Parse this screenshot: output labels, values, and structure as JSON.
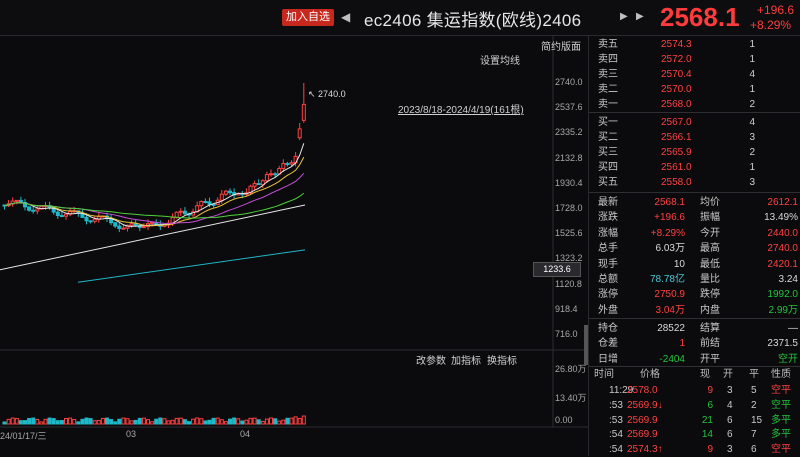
{
  "header": {
    "add_watchlist": "加入自选",
    "prev": "◀",
    "title": "ec2406 集运指数(欧线)2406",
    "next": "▶",
    "next2": "▶",
    "last_price": "2568.1",
    "change": "+196.6",
    "change_pct": "+8.29%"
  },
  "chart_toolbar": {
    "simple_panel": "简约版面",
    "ma_settings": "设置均线",
    "date_range": "2023/8/18-2024/4/19(161根)",
    "peak_label": "2740.0",
    "current_tag": "1233.6",
    "edit_params": "改参数",
    "add_indicator": "加指标",
    "change_indicator": "换指标"
  },
  "chart_data": {
    "type": "candlestick",
    "price_axis": [
      "2740.0",
      "2537.6",
      "2335.2",
      "2132.8",
      "1930.4",
      "1728.0",
      "1525.6",
      "1323.2",
      "1120.8",
      "918.4",
      "716.0"
    ],
    "volume_axis": [
      "26.80万",
      "13.40万",
      "0.00"
    ],
    "x_ticks": [
      "24/01/17/三",
      "03",
      "04"
    ],
    "peak": 2740.0,
    "colors": {
      "up": "#ff4040",
      "down": "#1fb8c8",
      "ma5": "#e8e8e8",
      "ma10": "#e8c33a",
      "ma20": "#c54fd6",
      "ma60": "#4dd23a",
      "ma120": "#e8e8e8",
      "ma250": "#1fb8c8"
    }
  },
  "order_book": {
    "asks": [
      {
        "label": "卖五",
        "price": "2574.3",
        "vol": "1"
      },
      {
        "label": "卖四",
        "price": "2572.0",
        "vol": "1"
      },
      {
        "label": "卖三",
        "price": "2570.4",
        "vol": "4"
      },
      {
        "label": "卖二",
        "price": "2570.0",
        "vol": "1"
      },
      {
        "label": "卖一",
        "price": "2568.0",
        "vol": "2"
      }
    ],
    "bids": [
      {
        "label": "买一",
        "price": "2567.0",
        "vol": "4"
      },
      {
        "label": "买二",
        "price": "2566.1",
        "vol": "3"
      },
      {
        "label": "买三",
        "price": "2565.9",
        "vol": "2"
      },
      {
        "label": "买四",
        "price": "2561.0",
        "vol": "1"
      },
      {
        "label": "买五",
        "price": "2558.0",
        "vol": "3"
      }
    ]
  },
  "quote": [
    {
      "l1": "最新",
      "v1": "2568.1",
      "c1": "red",
      "l2": "均价",
      "v2": "2612.1",
      "c2": "red"
    },
    {
      "l1": "涨跌",
      "v1": "+196.6",
      "c1": "red",
      "l2": "振幅",
      "v2": "13.49%",
      "c2": "white"
    },
    {
      "l1": "涨幅",
      "v1": "+8.29%",
      "c1": "red",
      "l2": "今开",
      "v2": "2440.0",
      "c2": "red"
    },
    {
      "l1": "总手",
      "v1": "6.03万",
      "c1": "white",
      "l2": "最高",
      "v2": "2740.0",
      "c2": "red"
    },
    {
      "l1": "现手",
      "v1": "10",
      "c1": "white",
      "l2": "最低",
      "v2": "2420.1",
      "c2": "red"
    },
    {
      "l1": "总额",
      "v1": "78.78亿",
      "c1": "cyan",
      "l2": "量比",
      "v2": "3.24",
      "c2": "white"
    },
    {
      "l1": "涨停",
      "v1": "2750.9",
      "c1": "red",
      "l2": "跌停",
      "v2": "1992.0",
      "c2": "green"
    },
    {
      "l1": "外盘",
      "v1": "3.04万",
      "c1": "red",
      "l2": "内盘",
      "v2": "2.99万",
      "c2": "green"
    }
  ],
  "position": [
    {
      "l1": "持仓",
      "v1": "28522",
      "c1": "white",
      "l2": "结算",
      "v2": "—",
      "c2": "white"
    },
    {
      "l1": "仓差",
      "v1": "1",
      "c1": "red",
      "l2": "前结",
      "v2": "2371.5",
      "c2": "white"
    },
    {
      "l1": "日增",
      "v1": "-2404",
      "c1": "green",
      "l2": "开平",
      "v2": "空开",
      "c2": "green"
    }
  ],
  "ticks_header": {
    "time": "时间",
    "price": "价格",
    "now": "现",
    "open": "开",
    "close": "平",
    "nature": "性质"
  },
  "ticks": [
    {
      "time": "11:29",
      "price": "2578.0",
      "pc": "red",
      "now": "9",
      "nc": "red",
      "open": "3",
      "close": "5",
      "nature": "空平",
      "tc": "red"
    },
    {
      "time": ":53",
      "price": "2569.9↓",
      "pc": "red",
      "now": "6",
      "nc": "green",
      "open": "4",
      "close": "2",
      "nature": "空平",
      "tc": "green"
    },
    {
      "time": ":53",
      "price": "2569.9",
      "pc": "red",
      "now": "21",
      "nc": "green",
      "open": "6",
      "close": "15",
      "nature": "多平",
      "tc": "green"
    },
    {
      "time": ":54",
      "price": "2569.9",
      "pc": "red",
      "now": "14",
      "nc": "green",
      "open": "6",
      "close": "7",
      "nature": "多平",
      "tc": "green"
    },
    {
      "time": ":54",
      "price": "2574.3↑",
      "pc": "red",
      "now": "9",
      "nc": "red",
      "open": "3",
      "close": "6",
      "nature": "空平",
      "tc": "red"
    }
  ]
}
